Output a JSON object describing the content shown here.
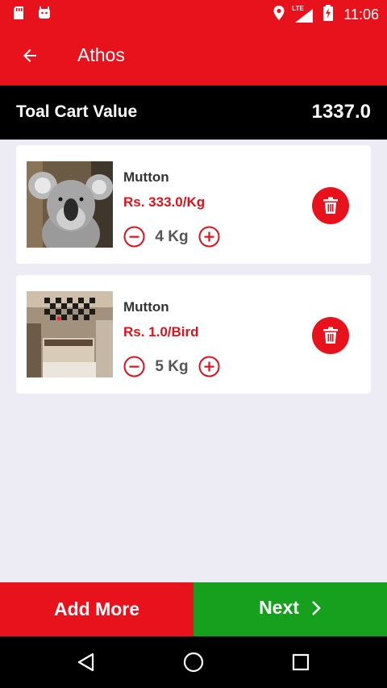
{
  "status_bar": {
    "time": "11:06",
    "network": "LTE"
  },
  "app_bar": {
    "title": "Athos"
  },
  "cart_summary": {
    "label": "Toal Cart Value",
    "value": "1337.0"
  },
  "cart_items": [
    {
      "name": "Mutton",
      "price": "Rs. 333.0/Kg",
      "quantity": "4 Kg"
    },
    {
      "name": "Mutton",
      "price": "Rs. 1.0/Bird",
      "quantity": "5 Kg"
    }
  ],
  "bottom_actions": {
    "add_more_label": "Add More",
    "next_label": "Next"
  },
  "colors": {
    "primary_red": "#e8121c",
    "accent_green": "#16a01e",
    "price_red": "#d9141e"
  }
}
